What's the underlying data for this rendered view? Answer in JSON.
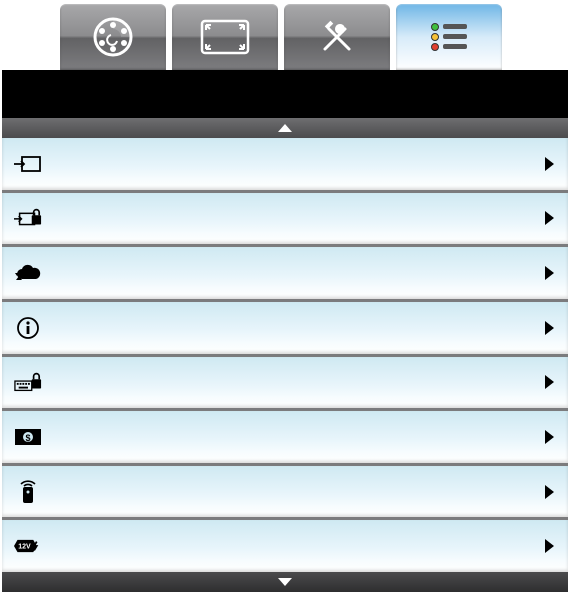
{
  "tabs": [
    {
      "name": "color-tab",
      "icon": "palette-icon",
      "active": false
    },
    {
      "name": "display-tab",
      "icon": "expand-icon",
      "active": false
    },
    {
      "name": "tools-tab",
      "icon": "tools-icon",
      "active": false
    },
    {
      "name": "settings-tab",
      "icon": "list-icon",
      "active": true
    }
  ],
  "menu": {
    "items": [
      {
        "name": "input-item",
        "icon": "input-icon",
        "label": ""
      },
      {
        "name": "input-lock-item",
        "icon": "input-lock-icon",
        "label": ""
      },
      {
        "name": "cloud-item",
        "icon": "cloud-icon",
        "label": ""
      },
      {
        "name": "information-item",
        "icon": "info-icon",
        "label": ""
      },
      {
        "name": "security-lock-item",
        "icon": "keyboard-lock-icon",
        "label": ""
      },
      {
        "name": "dollar-item",
        "icon": "dollar-icon",
        "label": ""
      },
      {
        "name": "remote-item",
        "icon": "remote-icon",
        "label": ""
      },
      {
        "name": "power-12v-item",
        "icon": "power-12v-icon",
        "label": ""
      }
    ]
  },
  "icon_text": {
    "dollar": "$",
    "power": "12V"
  }
}
